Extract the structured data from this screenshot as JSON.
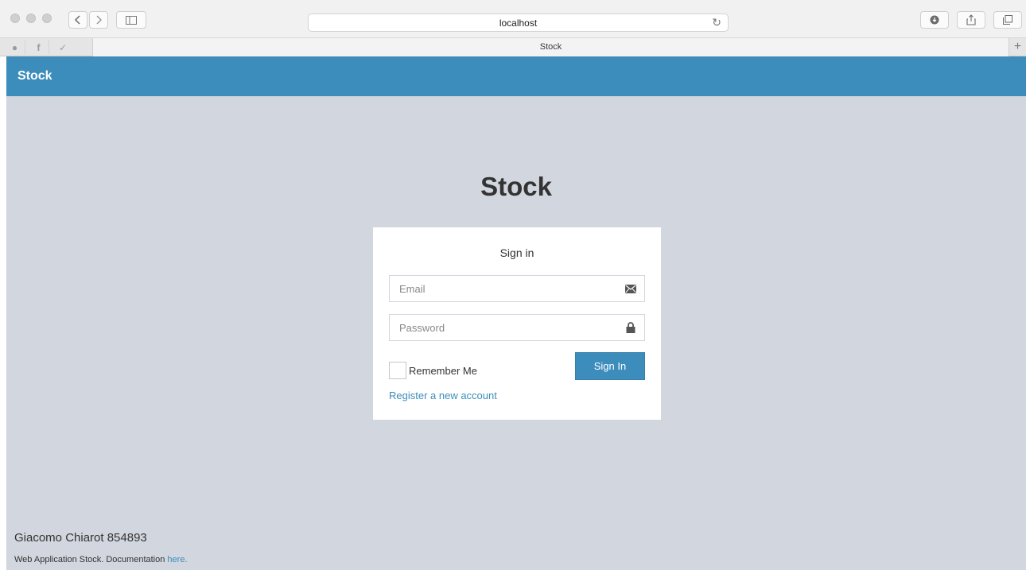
{
  "browser": {
    "url": "localhost",
    "tab_title": "Stock",
    "new_tab_label": "+"
  },
  "navbar": {
    "brand": "Stock"
  },
  "login": {
    "logo": "Stock",
    "box_message": "Sign in",
    "email_placeholder": "Email",
    "password_placeholder": "Password",
    "remember_label": "Remember Me",
    "signin_label": "Sign In",
    "register_label": "Register a new account"
  },
  "footer": {
    "name": "Giacomo Chiarot 854893",
    "doc_text": "Web Application Stock. Documentation",
    "doc_link": "here."
  },
  "colors": {
    "primary": "#3c8dbc",
    "page_bg": "#d2d6de"
  },
  "icons": {
    "email": "envelope-icon",
    "password": "lock-icon"
  }
}
